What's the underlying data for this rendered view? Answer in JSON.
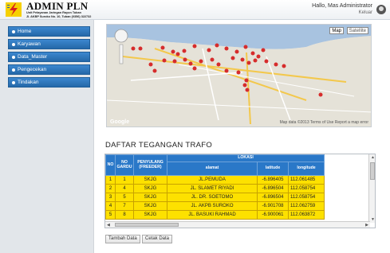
{
  "header": {
    "title": "ADMIN PLN",
    "subtitle1": "Unit Pelayanan Jaringan Rayon Tuban",
    "subtitle2": "Jl. AKBP Suroko No. 10, Tuban (0356) 322732",
    "greeting": "Hallo, Mas Administrator",
    "logout": "Keluar"
  },
  "sidebar": {
    "items": [
      {
        "label": "Home"
      },
      {
        "label": "Karyawan"
      },
      {
        "label": "Data_Master"
      },
      {
        "label": "Pengecekan"
      },
      {
        "label": "Tindakan"
      }
    ]
  },
  "map": {
    "btn_map": "Map",
    "btn_satellite": "Satellite",
    "attribution": "Map data ©2013 Terms of Use   Report a map error",
    "google": "Google"
  },
  "main": {
    "title": "DAFTAR TEGANGAN TRAFO",
    "table": {
      "headers": {
        "no": "NO",
        "no_gardu": "NO GARDU",
        "penyulang": "PENYULANG (FREEDER)",
        "lokasi": "LOKASI",
        "alamat": "alamat",
        "latitude": "latitude",
        "longitude": "longitude"
      },
      "rows": [
        {
          "no": "1",
          "gardu": "1",
          "penyulang": "SKJG",
          "alamat": "JL.PEMUDA",
          "lat": "-6.896405",
          "lng": "112.061485"
        },
        {
          "no": "2",
          "gardu": "4",
          "penyulang": "SKJG",
          "alamat": "JL. SLAMET RIYADI",
          "lat": "-6.896504",
          "lng": "112.058754"
        },
        {
          "no": "3",
          "gardu": "5",
          "penyulang": "SKJG",
          "alamat": "JL. DR. SOETOMO",
          "lat": "-6.896504",
          "lng": "112.058754"
        },
        {
          "no": "4",
          "gardu": "7",
          "penyulang": "SKJG",
          "alamat": "JL. AKPB SUROKO",
          "lat": "-6.901708",
          "lng": "112.062759"
        },
        {
          "no": "5",
          "gardu": "8",
          "penyulang": "SKJG",
          "alamat": "JL. BASUKI RAHMAD",
          "lat": "-6.900061",
          "lng": "112.063872"
        }
      ]
    },
    "btn_add": "Tambah Data",
    "btn_print": "Cetak Data"
  },
  "colors": {
    "nav_blue": "#2a78c8",
    "row_yellow": "#fde100",
    "marker_red": "#d62c2c"
  }
}
